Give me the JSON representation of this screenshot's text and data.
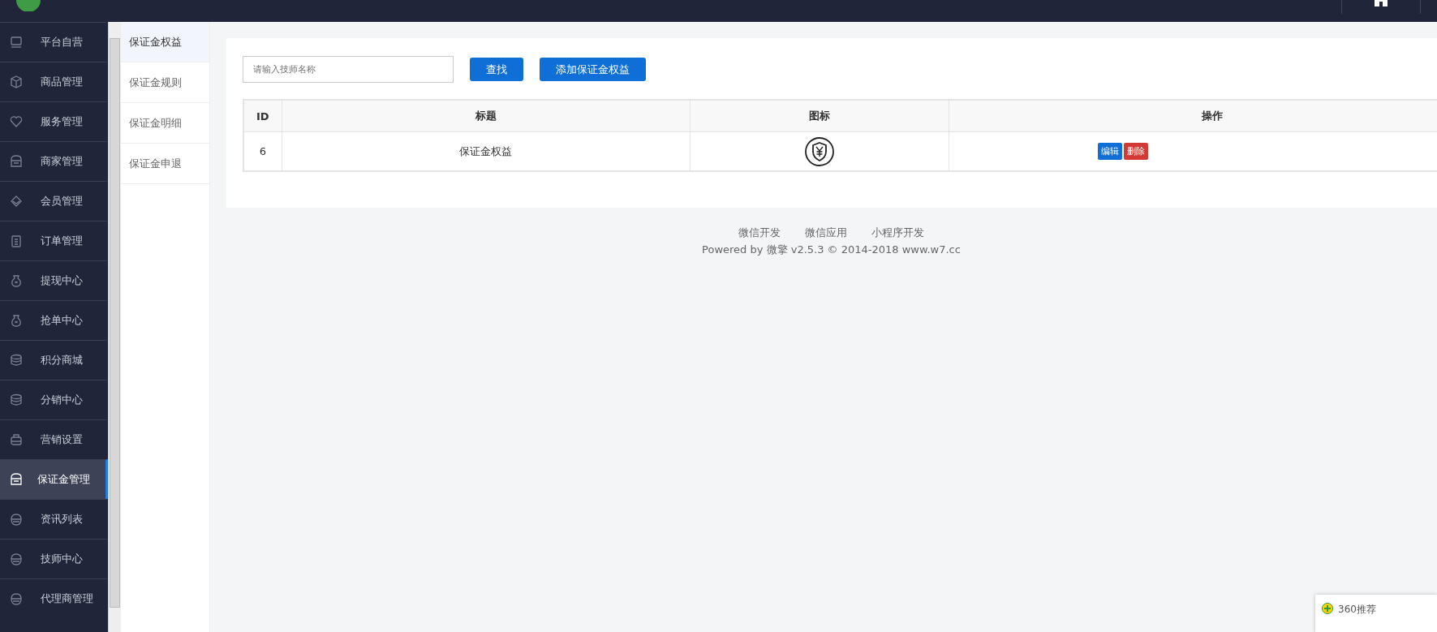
{
  "sidebar": {
    "items": [
      {
        "label": "平台自营",
        "kind": "monitor",
        "selected": false
      },
      {
        "label": "商品管理",
        "kind": "box",
        "selected": false
      },
      {
        "label": "服务管理",
        "kind": "heart",
        "selected": false
      },
      {
        "label": "商家管理",
        "kind": "shop",
        "selected": false
      },
      {
        "label": "会员管理",
        "kind": "diamond",
        "selected": false
      },
      {
        "label": "订单管理",
        "kind": "clipboard",
        "selected": false
      },
      {
        "label": "提现中心",
        "kind": "bag",
        "selected": false
      },
      {
        "label": "抢单中心",
        "kind": "bag",
        "selected": false
      },
      {
        "label": "积分商城",
        "kind": "stack",
        "selected": false
      },
      {
        "label": "分销中心",
        "kind": "stack",
        "selected": false
      },
      {
        "label": "营销设置",
        "kind": "toolbox",
        "selected": false
      },
      {
        "label": "保证金管理",
        "kind": "shop",
        "selected": true
      },
      {
        "label": "资讯列表",
        "kind": "helmet",
        "selected": false
      },
      {
        "label": "技师中心",
        "kind": "helmet",
        "selected": false
      },
      {
        "label": "代理商管理",
        "kind": "helmet",
        "selected": false
      }
    ]
  },
  "submenu": {
    "items": [
      {
        "label": "保证金权益",
        "selected": true
      },
      {
        "label": "保证金规则",
        "selected": false
      },
      {
        "label": "保证金明细",
        "selected": false
      },
      {
        "label": "保证金申退",
        "selected": false
      }
    ]
  },
  "toolbar": {
    "search": {
      "placeholder": "请输入技师名称"
    },
    "search_button": "查找",
    "add_button": "添加保证金权益"
  },
  "table": {
    "columns": [
      "ID",
      "标题",
      "图标",
      "操作"
    ],
    "rows": [
      {
        "id": "6",
        "title": "保证金权益",
        "actions": [
          "编辑",
          "删除"
        ]
      }
    ]
  },
  "footer": {
    "links": [
      "微信开发",
      "微信应用",
      "小程序开发"
    ],
    "powered": "Powered by 微擎 v2.5.3 © 2014-2018 www.w7.cc"
  },
  "popup": {
    "label": "360推荐"
  }
}
